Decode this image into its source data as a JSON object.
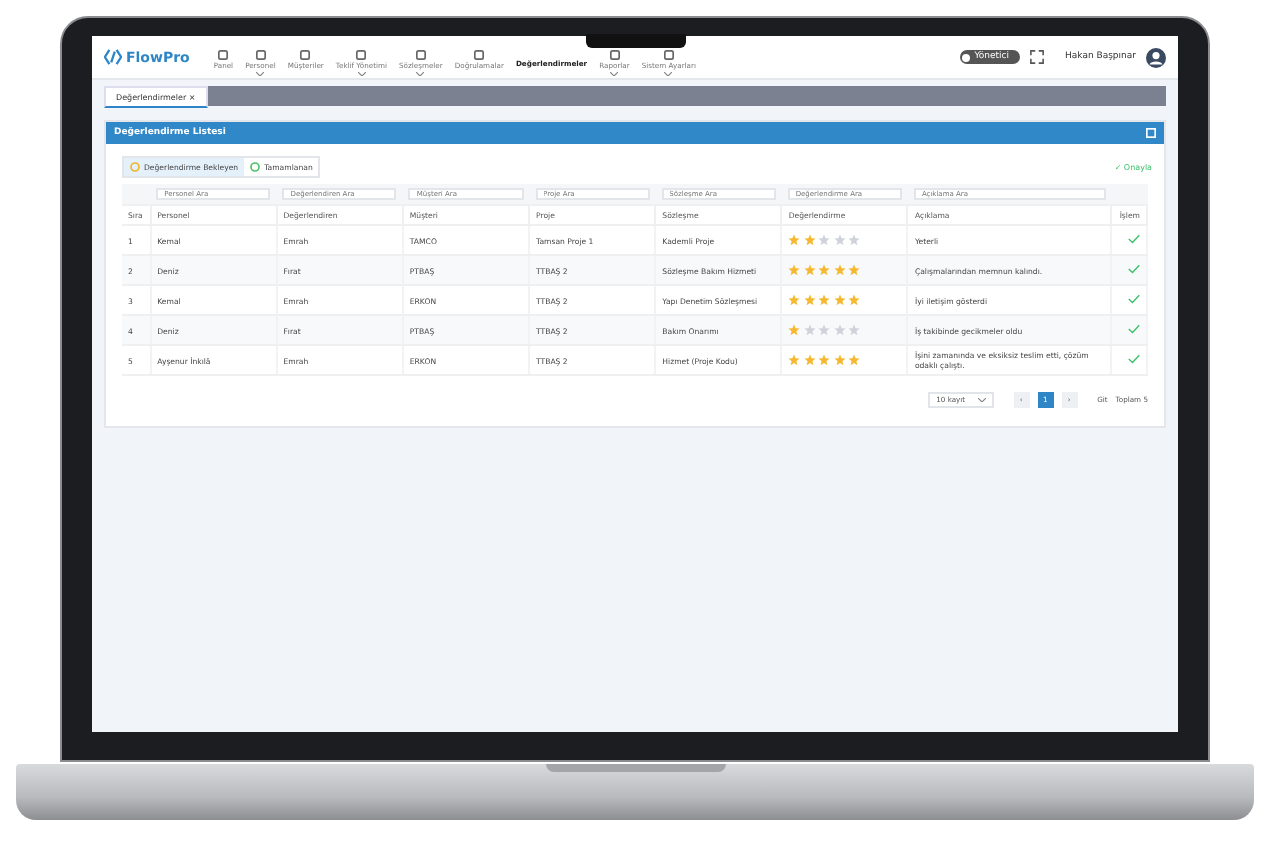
{
  "app": {
    "logo": "FlowPro",
    "nav": [
      {
        "label": "Panel",
        "selected": false,
        "dropdown": false
      },
      {
        "label": "Personel",
        "selected": false,
        "dropdown": true
      },
      {
        "label": "Müşteriler",
        "selected": false,
        "dropdown": false
      },
      {
        "label": "Teklif Yönetimi",
        "selected": false,
        "dropdown": true
      },
      {
        "label": "Sözleşmeler",
        "selected": false,
        "dropdown": true
      },
      {
        "label": "Doğrulamalar",
        "selected": false,
        "dropdown": false
      },
      {
        "label": "Değerlendirmeler",
        "selected": true,
        "dropdown": false
      },
      {
        "label": "Raporlar",
        "selected": false,
        "dropdown": true
      },
      {
        "label": "Sistem Ayarları",
        "selected": false,
        "dropdown": true
      }
    ],
    "mode_toggle": {
      "label": "Yönetici",
      "on": false
    },
    "user": "Hakan Başpınar"
  },
  "tabs": [
    {
      "label": "Değerlendirmeler",
      "close": "×",
      "selected": true
    }
  ],
  "card": {
    "title": "Değerlendirme Listesi",
    "filters": [
      {
        "label": "Değerlendirme Bekleyen",
        "selected": true,
        "color": "#f0b429"
      },
      {
        "label": "Tamamlanan",
        "selected": false,
        "color": "#4cc36a"
      }
    ],
    "action": "✓ Onayla",
    "table": {
      "search_placeholders": [
        "Personel Ara",
        "Değerlendiren Ara",
        "Müşteri Ara",
        "Proje Ara",
        "Sözleşme Ara",
        "Değerlendirme Ara",
        "Açıklama Ara"
      ],
      "columns": [
        "Sıra",
        "Personel",
        "Değerlendiren",
        "Müşteri",
        "Proje",
        "Sözleşme",
        "Değerlendirme",
        "Açıklama",
        "İşlem"
      ],
      "rows": [
        {
          "cells": [
            "1",
            "Kemal",
            "Emrah",
            "TAMCO",
            "Tamsan Proje 1",
            "Kademli Proje"
          ],
          "stars": 2,
          "note": "Yeterli",
          "done": true
        },
        {
          "cells": [
            "2",
            "Deniz",
            "Fırat",
            "PTBAŞ",
            "TTBAŞ 2",
            "Sözleşme Bakım Hizmeti"
          ],
          "stars": 5,
          "note": "Çalışmalarından memnun kalındı.",
          "done": true
        },
        {
          "cells": [
            "3",
            "Kemal",
            "Emrah",
            "ERKON",
            "TTBAŞ 2",
            "Yapı Denetim Sözleşmesi"
          ],
          "stars": 5,
          "note": "İyi iletişim gösterdi",
          "done": true
        },
        {
          "cells": [
            "4",
            "Deniz",
            "Fırat",
            "PTBAŞ",
            "TTBAŞ 2",
            "Bakım Onarımı"
          ],
          "stars": 1,
          "note": "İş takibinde gecikmeler oldu",
          "done": true
        },
        {
          "cells": [
            "5",
            "Ayşenur İnkılâ",
            "Emrah",
            "ERKON",
            "TTBAŞ 2",
            "Hizmet (Proje Kodu)"
          ],
          "stars": 5,
          "note": "İşini zamanında ve eksiksiz teslim etti, çözüm odaklı çalıştı.",
          "done": true
        }
      ]
    },
    "pagination": {
      "page_size": "10 kayıt",
      "prev": "‹",
      "pages": [
        {
          "label": "1",
          "selected": true
        }
      ],
      "next": "›",
      "goto": "Git",
      "total": "Toplam 5"
    }
  }
}
